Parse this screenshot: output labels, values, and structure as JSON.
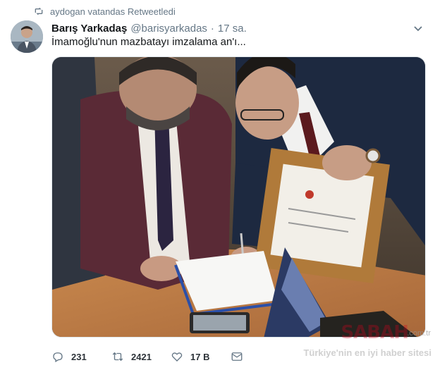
{
  "retweet": {
    "icon": "retweet-icon",
    "text": "aydogan vatandas Retweetledi"
  },
  "tweet": {
    "author_name": "Barış Yarkadaş",
    "handle": "@barisyarkadas",
    "separator": "·",
    "time": "17 sa.",
    "text": "İmamoğlu'nun mazbatayı imzalama an'ı..."
  },
  "actions": {
    "reply_count": "231",
    "retweet_count": "2421",
    "like_count": "17 B"
  },
  "watermark": {
    "brand": "SABAH",
    "tld": ".com.tr",
    "tagline": "Türkiye'nin en iyi haber sitesi"
  },
  "colors": {
    "muted": "#657786",
    "text": "#14171a",
    "brand_red": "#d0021b"
  }
}
